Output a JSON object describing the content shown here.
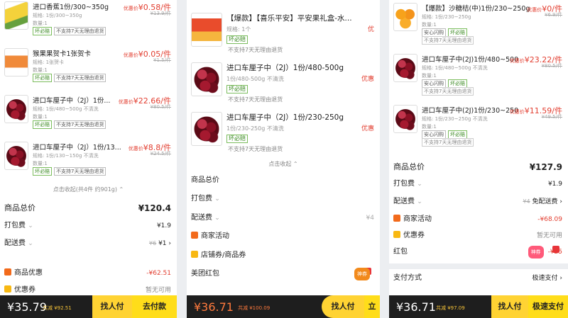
{
  "panel1": {
    "items": [
      {
        "title": "进口香蕉1份/300~350g",
        "spec": "规格: 1份/300~350g",
        "qty": "数量:1",
        "tags": [
          "坏必赔",
          "不支持7天无理由退货"
        ],
        "label": "优惠价",
        "price": "¥0.58/件",
        "orig": "¥13.9/件",
        "img": "banana"
      },
      {
        "title": "猴果果贺卡1张贺卡",
        "spec": "规格: 1张贺卡",
        "qty": "数量:1",
        "tags": [
          "坏必赔",
          "不支持7天无理由退货"
        ],
        "label": "优惠价",
        "price": "¥0.05/件",
        "orig": "¥1.5/件",
        "img": "card"
      },
      {
        "title": "进口车厘子中（2J）1份...",
        "spec": "规格: 1份/480~500g 不清洗",
        "qty": "数量:1",
        "tags": [
          "坏必赔",
          "不支持7天无理由退货"
        ],
        "label": "优惠价",
        "price": "¥22.66/件",
        "orig": "¥80.5/件",
        "img": "cherry"
      },
      {
        "title": "进口车厘子中（2J）1份/13...",
        "spec": "规格: 1份/130~150g 不清洗",
        "qty": "数量:1",
        "tags": [
          "坏必赔",
          "不支持7天无理由退货"
        ],
        "label": "优惠价",
        "price": "¥8.8/件",
        "orig": "¥24.5/件",
        "img": "cherry"
      }
    ],
    "collapse": "点击收起(共4件 约901g) ⌃",
    "total_label": "商品总价",
    "total": "¥120.4",
    "pack_label": "打包费",
    "pack": "¥1.9",
    "ship_label": "配送费",
    "ship_orig": "¥6",
    "ship": "¥1",
    "discount_label": "商品优惠",
    "discount": "-¥62.51",
    "coupon_label": "优惠券",
    "coupon": "暂无可用",
    "pay_amount": "¥35.79",
    "pay_saved": "共减 ¥92.51",
    "btn_friend": "找人付",
    "btn_pay": "去付款"
  },
  "panel2": {
    "items": [
      {
        "title": "【爆款】【喜乐平安】平安果礼盒-水...",
        "spec": "规格: 1个",
        "tags": [
          "坏必赔"
        ],
        "note": "不支持7天无理由退货",
        "img": "gift",
        "price": "优"
      },
      {
        "title": "进口车厘子中（2J）1份/480-500g",
        "spec": "1份/480-500g 不清洗",
        "tags": [
          "坏必赔"
        ],
        "note": "不支持7天无理由退货",
        "img": "cherry",
        "price": "优惠"
      },
      {
        "title": "进口车厘子中（2J）1份/230-250g",
        "spec": "1份/230-250g 不清洗",
        "tags": [
          "坏必赔"
        ],
        "note": "不支持7天无理由退货",
        "img": "cherry",
        "price": "优惠"
      }
    ],
    "collapse": "点击收起 ⌃",
    "total_label": "商品总价",
    "pack_label": "打包费",
    "ship_label": "配送费",
    "ship": "¥4",
    "activity_label": "商家活动",
    "voucher_label": "店铺券/商品券",
    "redpack_label": "美团红包",
    "redpack_tag": "神券",
    "pay_amount": "¥36.71",
    "pay_saved": "共减 ¥100.09",
    "btn_friend": "找人付",
    "btn_pay": "立"
  },
  "panel3": {
    "items": [
      {
        "title": "【爆款】沙糖桔(中)1份/230~250g",
        "spec": "规格: 1份/230~250g",
        "qty": "数量:1",
        "tags": [
          "安心闪购",
          "坏必赔"
        ],
        "note": "不支持7天无理由退货",
        "label": "优惠价",
        "price": "¥0/件",
        "orig": "¥6.9/件",
        "img": "orange"
      },
      {
        "title": "进口车厘子中(2J)1份/480~500",
        "spec": "规格: 1份/480~500g 不清洗",
        "qty": "数量:1",
        "tags": [
          "安心闪购",
          "坏必赔"
        ],
        "note": "不支持7天无理由退货",
        "label": "优惠价",
        "price": "¥23.22/件",
        "orig": "¥80.5/件",
        "img": "cherry"
      },
      {
        "title": "进口车厘子中(2J)1份/230~250",
        "spec": "规格: 1份/230~250g 不清洗",
        "qty": "数量:1",
        "tags": [
          "安心闪购",
          "坏必赔"
        ],
        "note": "不支持7天无理由退货",
        "label": "优惠价",
        "price": "¥11.59/件",
        "orig": "¥49.5/件",
        "img": "cherry"
      }
    ],
    "total_label": "商品总价",
    "total": "¥127.9",
    "pack_label": "打包费",
    "pack": "¥1.9",
    "ship_label": "配送费",
    "ship_orig": "¥4",
    "ship": "免配送费",
    "activity_label": "商家活动",
    "activity": "-¥68.09",
    "coupon_label": "优惠券",
    "coupon": "暂无可用",
    "redpack_label": "红包",
    "redpack_tag": "神券",
    "redpack": "-¥25",
    "method_label": "支付方式",
    "method": "极速支付",
    "pay_amount": "¥36.71",
    "pay_saved": "共减 ¥97.09",
    "btn_friend": "找人付",
    "btn_pay": "极速支付"
  }
}
